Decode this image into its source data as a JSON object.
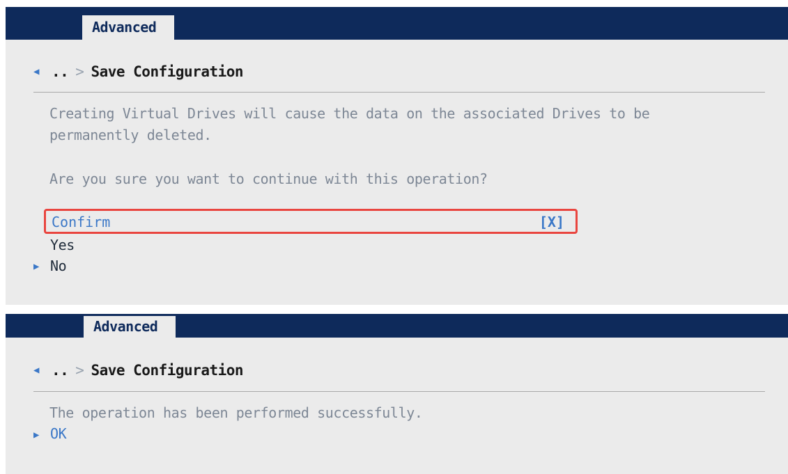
{
  "screens": [
    {
      "tab": "Advanced",
      "breadcrumb": {
        "back_icon": "left-arrow-icon",
        "parent": "..",
        "separator": ">",
        "current": "Save Configuration"
      },
      "message_lines": [
        "Creating Virtual Drives will cause the data on the associated Drives to be",
        "permanently deleted."
      ],
      "question": "Are you sure you want to continue with this operation?",
      "confirm": {
        "label": "Confirm",
        "value": "[X]"
      },
      "options": [
        "Yes",
        "No"
      ],
      "selected_icon": "right-pointer-icon"
    },
    {
      "tab": "Advanced",
      "breadcrumb": {
        "back_icon": "left-arrow-icon",
        "parent": "..",
        "separator": ">",
        "current": "Save Configuration"
      },
      "message": "The operation has been performed successfully.",
      "options": [
        "OK"
      ]
    }
  ],
  "colors": {
    "header_bg": "#0e2a5b",
    "panel_bg": "#ebebeb",
    "highlight_text": "#3a77c7",
    "message_text": "#7d8795",
    "annotation_box": "#e9453f"
  }
}
